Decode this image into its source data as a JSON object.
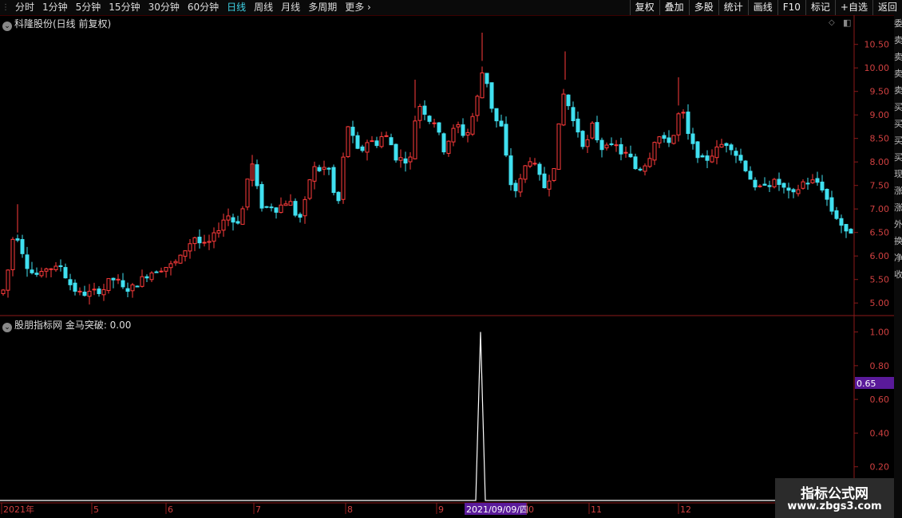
{
  "toolbar": {
    "periods": [
      "分时",
      "1分钟",
      "5分钟",
      "15分钟",
      "30分钟",
      "60分钟",
      "日线",
      "周线",
      "月线",
      "多周期",
      "更多"
    ],
    "active_period": "日线",
    "right_buttons": [
      "复权",
      "叠加",
      "多股",
      "统计",
      "画线",
      "F10",
      "标记",
      "+自选",
      "返回"
    ]
  },
  "main_panel": {
    "title": "科隆股份(日线 前复权)"
  },
  "indicator_panel": {
    "title": "股朋指标网 金马突破: 0.00"
  },
  "sidebar_chars": [
    "委",
    "卖",
    "卖",
    "卖",
    "卖",
    "买",
    "买",
    "买",
    "买",
    "现",
    "涨",
    "涨",
    "外",
    "换",
    "净",
    "收"
  ],
  "watermark": {
    "line1": "指标公式网",
    "line2": "www.zbgs3.com"
  },
  "colors": {
    "up": "#ff3b3b",
    "down": "#40e0f0",
    "axis": "#8b1a1a",
    "tick_text": "#d04040",
    "highlight": "#5a1a9a"
  },
  "chart_data": [
    {
      "type": "candlestick",
      "ylim": [
        4.8,
        10.8
      ],
      "y_ticks": [
        10.5,
        10.0,
        9.5,
        9.0,
        8.5,
        8.0,
        7.5,
        7.0,
        6.5,
        6.0,
        5.5,
        5.0
      ],
      "close_path": [
        [
          0,
          5.2
        ],
        [
          6,
          5.4
        ],
        [
          12,
          6.3
        ],
        [
          18,
          6.5
        ],
        [
          26,
          6.1
        ],
        [
          34,
          5.7
        ],
        [
          42,
          5.6
        ],
        [
          50,
          5.6
        ],
        [
          58,
          5.8
        ],
        [
          66,
          5.7
        ],
        [
          74,
          5.8
        ],
        [
          82,
          5.5
        ],
        [
          90,
          5.3
        ],
        [
          98,
          5.2
        ],
        [
          108,
          5.2
        ],
        [
          118,
          5.25
        ],
        [
          128,
          5.3
        ],
        [
          136,
          5.5
        ],
        [
          144,
          5.5
        ],
        [
          152,
          5.3
        ],
        [
          162,
          5.3
        ],
        [
          172,
          5.45
        ],
        [
          182,
          5.6
        ],
        [
          192,
          5.7
        ],
        [
          202,
          5.75
        ],
        [
          212,
          5.8
        ],
        [
          222,
          5.9
        ],
        [
          232,
          6.2
        ],
        [
          242,
          6.4
        ],
        [
          252,
          6.2
        ],
        [
          262,
          6.3
        ],
        [
          272,
          6.6
        ],
        [
          282,
          6.9
        ],
        [
          292,
          6.7
        ],
        [
          300,
          6.8
        ],
        [
          306,
          7.4
        ],
        [
          312,
          8.1
        ],
        [
          318,
          7.6
        ],
        [
          324,
          7.1
        ],
        [
          330,
          7.0
        ],
        [
          336,
          7.1
        ],
        [
          344,
          7.0
        ],
        [
          352,
          7.1
        ],
        [
          360,
          7.2
        ],
        [
          368,
          6.9
        ],
        [
          376,
          6.8
        ],
        [
          382,
          7.3
        ],
        [
          388,
          7.8
        ],
        [
          394,
          7.9
        ],
        [
          400,
          7.8
        ],
        [
          406,
          7.9
        ],
        [
          412,
          7.8
        ],
        [
          418,
          7.1
        ],
        [
          424,
          7.2
        ],
        [
          430,
          8.5
        ],
        [
          436,
          8.9
        ],
        [
          442,
          8.3
        ],
        [
          448,
          8.2
        ],
        [
          454,
          8.3
        ],
        [
          460,
          8.5
        ],
        [
          466,
          8.4
        ],
        [
          472,
          8.4
        ],
        [
          478,
          8.6
        ],
        [
          484,
          8.5
        ],
        [
          490,
          8.3
        ],
        [
          496,
          8.0
        ],
        [
          502,
          8.1
        ],
        [
          510,
          8.0
        ],
        [
          516,
          8.2
        ],
        [
          520,
          9.6
        ],
        [
          526,
          9.0
        ],
        [
          532,
          9.1
        ],
        [
          538,
          8.8
        ],
        [
          544,
          8.9
        ],
        [
          550,
          8.4
        ],
        [
          556,
          8.2
        ],
        [
          562,
          8.6
        ],
        [
          568,
          8.7
        ],
        [
          574,
          8.8
        ],
        [
          580,
          8.5
        ],
        [
          586,
          8.7
        ],
        [
          592,
          9.1
        ],
        [
          598,
          9.5
        ],
        [
          604,
          10.1
        ],
        [
          610,
          9.5
        ],
        [
          616,
          9.0
        ],
        [
          622,
          8.8
        ],
        [
          628,
          8.7
        ],
        [
          634,
          7.8
        ],
        [
          640,
          7.4
        ],
        [
          646,
          7.4
        ],
        [
          652,
          7.7
        ],
        [
          658,
          8.0
        ],
        [
          664,
          8.1
        ],
        [
          670,
          7.8
        ],
        [
          676,
          7.6
        ],
        [
          682,
          7.4
        ],
        [
          688,
          7.8
        ],
        [
          694,
          8.0
        ],
        [
          700,
          9.1
        ],
        [
          706,
          9.6
        ],
        [
          712,
          9.0
        ],
        [
          718,
          8.8
        ],
        [
          724,
          8.6
        ],
        [
          730,
          8.3
        ],
        [
          736,
          8.5
        ],
        [
          742,
          8.9
        ],
        [
          748,
          8.3
        ],
        [
          754,
          8.3
        ],
        [
          760,
          8.5
        ],
        [
          766,
          8.2
        ],
        [
          772,
          8.4
        ],
        [
          778,
          8.1
        ],
        [
          784,
          8.2
        ],
        [
          790,
          8.0
        ],
        [
          796,
          7.8
        ],
        [
          802,
          7.9
        ],
        [
          808,
          8.0
        ],
        [
          814,
          8.2
        ],
        [
          820,
          8.6
        ],
        [
          826,
          8.5
        ],
        [
          832,
          8.4
        ],
        [
          838,
          8.5
        ],
        [
          844,
          8.6
        ],
        [
          850,
          9.2
        ],
        [
          856,
          8.9
        ],
        [
          862,
          8.4
        ],
        [
          868,
          8.3
        ],
        [
          874,
          8.1
        ],
        [
          880,
          8.0
        ],
        [
          886,
          8.1
        ],
        [
          892,
          8.2
        ],
        [
          898,
          8.3
        ],
        [
          904,
          8.4
        ],
        [
          910,
          8.4
        ],
        [
          916,
          8.3
        ],
        [
          922,
          8.1
        ],
        [
          928,
          8.0
        ],
        [
          934,
          7.8
        ],
        [
          940,
          7.6
        ],
        [
          946,
          7.3
        ],
        [
          952,
          7.5
        ],
        [
          958,
          7.6
        ],
        [
          964,
          7.5
        ],
        [
          970,
          7.6
        ],
        [
          976,
          7.5
        ],
        [
          982,
          7.4
        ],
        [
          988,
          7.3
        ],
        [
          994,
          7.3
        ],
        [
          1000,
          7.5
        ],
        [
          1006,
          7.6
        ],
        [
          1012,
          7.55
        ],
        [
          1018,
          7.6
        ],
        [
          1024,
          7.55
        ],
        [
          1030,
          7.4
        ],
        [
          1036,
          7.1
        ],
        [
          1042,
          6.9
        ],
        [
          1048,
          6.8
        ],
        [
          1054,
          6.6
        ],
        [
          1060,
          6.4
        ],
        [
          1066,
          6.6
        ]
      ]
    },
    {
      "type": "line",
      "ylim": [
        0,
        1.05
      ],
      "y_ticks": [
        1.0,
        0.8,
        0.6,
        0.4,
        0.2
      ],
      "series": [
        {
          "x": [
            0,
            596,
            602,
            608,
            1070
          ],
          "y": [
            0,
            0,
            1.0,
            0,
            0
          ]
        }
      ],
      "current_value_tag": "0.65",
      "x_tick_labels": [
        "2021年",
        "5",
        "6",
        "7",
        "8",
        "9",
        "2021/09/09/四",
        "0",
        "11",
        "12"
      ],
      "x_tick_positions_label_hint": "months"
    }
  ]
}
